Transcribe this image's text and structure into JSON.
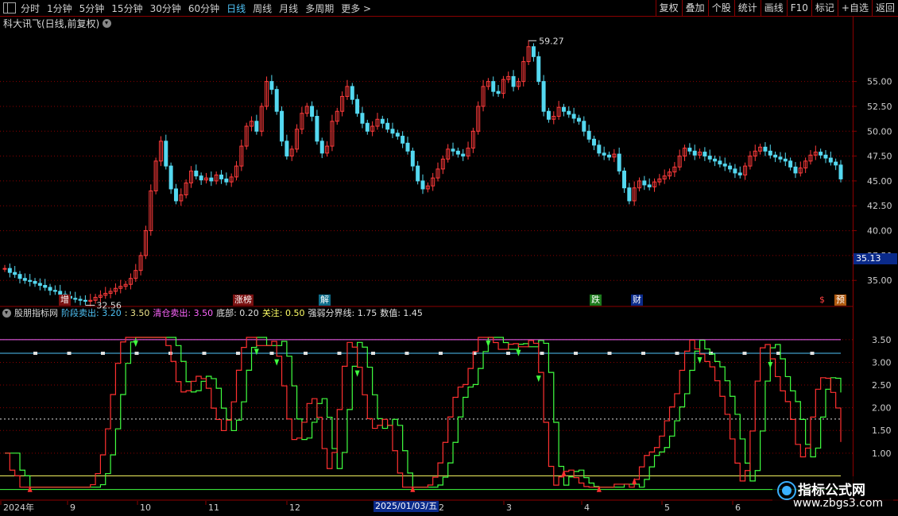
{
  "toolbar": {
    "periods": [
      "分时",
      "1分钟",
      "5分钟",
      "15分钟",
      "30分钟",
      "60分钟",
      "日线",
      "周线",
      "月线",
      "多周期",
      "更多 >"
    ],
    "active_period": "日线",
    "buttons": [
      "复权",
      "叠加",
      "个股",
      "统计",
      "画线",
      "F10",
      "标记",
      "+自选",
      "返回"
    ]
  },
  "main_chart": {
    "title": "科大讯飞(日线,前复权)",
    "price_ticks": [
      "55.00",
      "52.50",
      "50.00",
      "47.50",
      "45.00",
      "42.50",
      "40.00",
      "37.50",
      "35.00"
    ],
    "high_label": "59.27",
    "low_label": "32.56",
    "current_price": "35.13",
    "events": [
      {
        "label": "增",
        "color": "#ffffff",
        "bg": "#7a1010"
      },
      {
        "label": "涨榜",
        "color": "#ffffff",
        "bg": "#7a1010"
      },
      {
        "label": "解",
        "color": "#ffffff",
        "bg": "#0d6d8a"
      },
      {
        "label": "跌",
        "color": "#ffffff",
        "bg": "#1c7a1c"
      },
      {
        "label": "财",
        "color": "#ffffff",
        "bg": "#0a2a8a"
      },
      {
        "label": "$",
        "color": "#ff4040",
        "bg": "#000000"
      },
      {
        "label": "预",
        "color": "#ffffff",
        "bg": "#b05a10"
      }
    ]
  },
  "indicator": {
    "name": "股朋指标网",
    "params": [
      {
        "text": "阶段卖出: 3.20",
        "color": "#4fc3f7"
      },
      {
        "text": ": 3.50",
        "color": "#f0e68c"
      },
      {
        "text": "清仓卖出: 3.50",
        "color": "#ff66ff"
      },
      {
        "text": "底部: 0.20",
        "color": "#e0e0e0"
      },
      {
        "text": "关注: 0.50",
        "color": "#ffff66"
      },
      {
        "text": "强弱分界线: 1.75",
        "color": "#e0e0e0"
      },
      {
        "text": "数值: 1.45",
        "color": "#e0e0e0"
      }
    ],
    "ticks": [
      "3.50",
      "3.00",
      "2.50",
      "2.00",
      "1.50",
      "1.00"
    ]
  },
  "x_axis": {
    "labels": [
      "2024年",
      "9",
      "10",
      "11",
      "12",
      "2025/01/03/五",
      "2",
      "3",
      "4",
      "5",
      "6"
    ]
  },
  "watermark": {
    "line1": "指标公式网",
    "line2": "www.zbgs3.com"
  },
  "colors": {
    "up": "#ff3b3b",
    "down": "#54d8f0",
    "grid": "#8b0000",
    "line_red": "#ff3030",
    "line_green": "#40ff40"
  },
  "chart_data": {
    "type": "candlestick",
    "title": "科大讯飞(日线,前复权)",
    "price_ylim": [
      33.5,
      60
    ],
    "close": [
      36.2,
      35.8,
      35.6,
      35.2,
      35.0,
      34.9,
      34.7,
      34.5,
      34.3,
      34.0,
      33.9,
      33.6,
      33.4,
      33.2,
      33.1,
      33.0,
      32.9,
      33.0,
      33.3,
      33.5,
      33.7,
      33.9,
      34.2,
      34.4,
      34.6,
      35.2,
      36.0,
      37.5,
      40.0,
      44.0,
      47.0,
      49.0,
      46.5,
      44.2,
      43.0,
      43.6,
      44.8,
      46.0,
      45.5,
      45.1,
      45.3,
      45.0,
      45.6,
      45.2,
      44.9,
      45.4,
      46.5,
      48.5,
      50.5,
      51.0,
      50.0,
      52.5,
      55.0,
      54.2,
      52.0,
      49.0,
      47.5,
      48.2,
      50.2,
      51.8,
      52.5,
      51.5,
      49.0,
      47.8,
      48.5,
      51.0,
      52.0,
      53.5,
      54.5,
      53.2,
      51.8,
      50.8,
      50.0,
      50.5,
      51.2,
      50.8,
      50.2,
      49.8,
      49.5,
      48.8,
      48.0,
      46.5,
      45.0,
      44.2,
      44.5,
      45.3,
      46.2,
      47.2,
      48.2,
      48.0,
      47.7,
      47.5,
      48.3,
      50.0,
      52.5,
      54.5,
      55.0,
      54.0,
      53.8,
      55.2,
      55.5,
      54.5,
      55.0,
      57.0,
      58.5,
      57.5,
      55.0,
      52.0,
      51.2,
      51.5,
      52.4,
      52.0,
      51.7,
      51.3,
      51.0,
      50.0,
      49.2,
      48.6,
      47.8,
      47.6,
      47.4,
      47.7,
      46.0,
      44.3,
      43.0,
      44.3,
      45.0,
      44.6,
      44.4,
      44.9,
      45.2,
      45.5,
      45.9,
      46.4,
      47.5,
      48.3,
      48.0,
      47.6,
      47.9,
      47.5,
      47.2,
      47.0,
      46.7,
      46.5,
      46.2,
      45.8,
      45.6,
      46.5,
      47.5,
      48.0,
      48.4,
      48.0,
      47.6,
      47.4,
      47.2,
      47.0,
      46.4,
      45.8,
      46.3,
      47.0,
      47.6,
      47.9,
      47.6,
      47.3,
      46.9,
      46.6,
      45.2
    ],
    "indicator_ylim": [
      0,
      3.9
    ],
    "levels": {
      "阶段卖出": 3.2,
      "清仓卖出": 3.5,
      "底部": 0.2,
      "关注": 0.5,
      "强弱分界线": 1.75,
      "数值": 1.45
    }
  }
}
